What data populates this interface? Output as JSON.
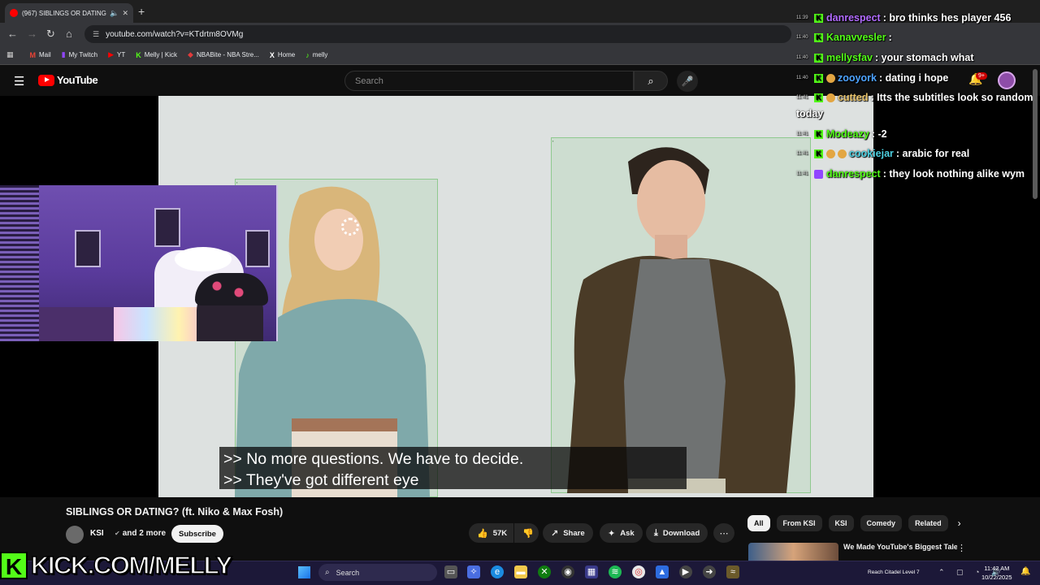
{
  "browser": {
    "tab_title": "(967) SIBLINGS OR DATING",
    "url": "youtube.com/watch?v=KTdrtm8OVMg",
    "bookmarks": [
      {
        "icon": "mail-icon",
        "label": "Mail",
        "color": "#ea4335",
        "glyph": "M"
      },
      {
        "icon": "twitch-icon",
        "label": "My Twitch",
        "color": "#9146ff",
        "glyph": "▮"
      },
      {
        "icon": "youtube-icon",
        "label": "YT",
        "color": "#ff0000",
        "glyph": "▶"
      },
      {
        "icon": "kick-icon",
        "label": "Melly | Kick",
        "color": "#53fc18",
        "glyph": "K"
      },
      {
        "icon": "nba-icon",
        "label": "NBABite - NBA Stre...",
        "color": "#e23b3b",
        "glyph": "◆"
      },
      {
        "icon": "x-icon",
        "label": "Home",
        "color": "#ffffff",
        "glyph": "X"
      },
      {
        "icon": "bookmark-icon",
        "label": "melly",
        "color": "#53fc18",
        "glyph": "♪"
      }
    ]
  },
  "youtube": {
    "logo_text": "YouTube",
    "search_placeholder": "Search",
    "notification_badge": "9+"
  },
  "subtitles": {
    "line1": ">> No more questions. We have to decide.",
    "line2": ">> They've got different eye"
  },
  "video": {
    "title": "SIBLINGS OR DATING? (ft. Niko & Max Fosh)",
    "channel": "KSI",
    "channel_more": "and 2 more",
    "subscribe_label": "Subscribe",
    "likes": "57K",
    "share_label": "Share",
    "ask_label": "Ask",
    "download_label": "Download"
  },
  "chips": [
    "All",
    "From KSI",
    "KSI",
    "Comedy",
    "Related"
  ],
  "recommendation": {
    "title": "We Made YouTube's Biggest Talent Show"
  },
  "chat": [
    {
      "time": "11:39",
      "badge": "kick",
      "user": "danrespect",
      "color": "#b26bff",
      "text": "bro thinks hes player 456"
    },
    {
      "time": "11:40",
      "badge": "kick",
      "user": "Kanavvesler",
      "color": "#53fc18",
      "text": ""
    },
    {
      "time": "11:40",
      "badge": "kick",
      "user": "mellysfav",
      "color": "#53fc18",
      "text": "your stomach what"
    },
    {
      "time": "11:40",
      "badge": "kick-crown",
      "user": "zooyork",
      "color": "#4da3ff",
      "text": "dating i hope"
    },
    {
      "time": "11:41",
      "badge": "kick-crown",
      "user": "cutted",
      "color": "#e8c36a",
      "text": "Itts the subtitles look so random"
    },
    {
      "time": "",
      "badge": "",
      "user": "",
      "color": "#ffffff",
      "text": "today"
    },
    {
      "time": "11:41",
      "badge": "kick",
      "user": "Modeazy",
      "color": "#53fc18",
      "text": "-2"
    },
    {
      "time": "11:41",
      "badge": "kick-crown",
      "user": "cookiejar",
      "color": "#4dd0e1",
      "text": "arabic for real"
    },
    {
      "time": "11:41",
      "badge": "twitch",
      "user": "danrespect",
      "color": "#53fc18",
      "text": "they look nothing alike wym"
    }
  ],
  "overlay": {
    "kick_url": "KICK.COM/MELLY"
  },
  "taskbar": {
    "search_label": "Search",
    "tray_text": "Reach Citadel Level 7",
    "time": "11:42 AM",
    "date": "10/22/2025"
  },
  "colors": {
    "kick_green": "#53fc18",
    "youtube_red": "#ff0000"
  }
}
